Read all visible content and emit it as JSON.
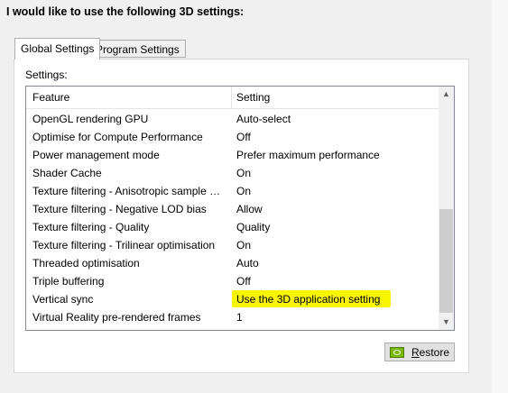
{
  "heading": "I would like to use the following 3D settings:",
  "tabs": [
    {
      "label": "Global Settings",
      "active": true
    },
    {
      "label": "Program Settings",
      "active": false
    }
  ],
  "settings_label": "Settings:",
  "table": {
    "columns": [
      "Feature",
      "Setting"
    ],
    "rows": [
      {
        "feature": "OpenGL rendering GPU",
        "setting": "Auto-select"
      },
      {
        "feature": "Optimise for Compute Performance",
        "setting": "Off"
      },
      {
        "feature": "Power management mode",
        "setting": "Prefer maximum performance"
      },
      {
        "feature": "Shader Cache",
        "setting": "On"
      },
      {
        "feature": "Texture filtering - Anisotropic sample opti...",
        "setting": "On"
      },
      {
        "feature": "Texture filtering - Negative LOD bias",
        "setting": "Allow"
      },
      {
        "feature": "Texture filtering - Quality",
        "setting": "Quality"
      },
      {
        "feature": "Texture filtering - Trilinear optimisation",
        "setting": "On"
      },
      {
        "feature": "Threaded optimisation",
        "setting": "Auto"
      },
      {
        "feature": "Triple buffering",
        "setting": "Off"
      },
      {
        "feature": "Vertical sync",
        "setting": "Use the 3D application setting",
        "highlighted": true
      },
      {
        "feature": "Virtual Reality pre-rendered frames",
        "setting": "1"
      }
    ]
  },
  "scrollbar": {
    "up_icon": "scroll-up-arrow",
    "down_icon": "scroll-down-arrow"
  },
  "restore_button": {
    "label_underlined": "R",
    "label_rest": "estore",
    "icon": "nvidia-logo-icon"
  },
  "colors": {
    "highlight": "#f7f500",
    "nvidia_green": "#76b900"
  }
}
